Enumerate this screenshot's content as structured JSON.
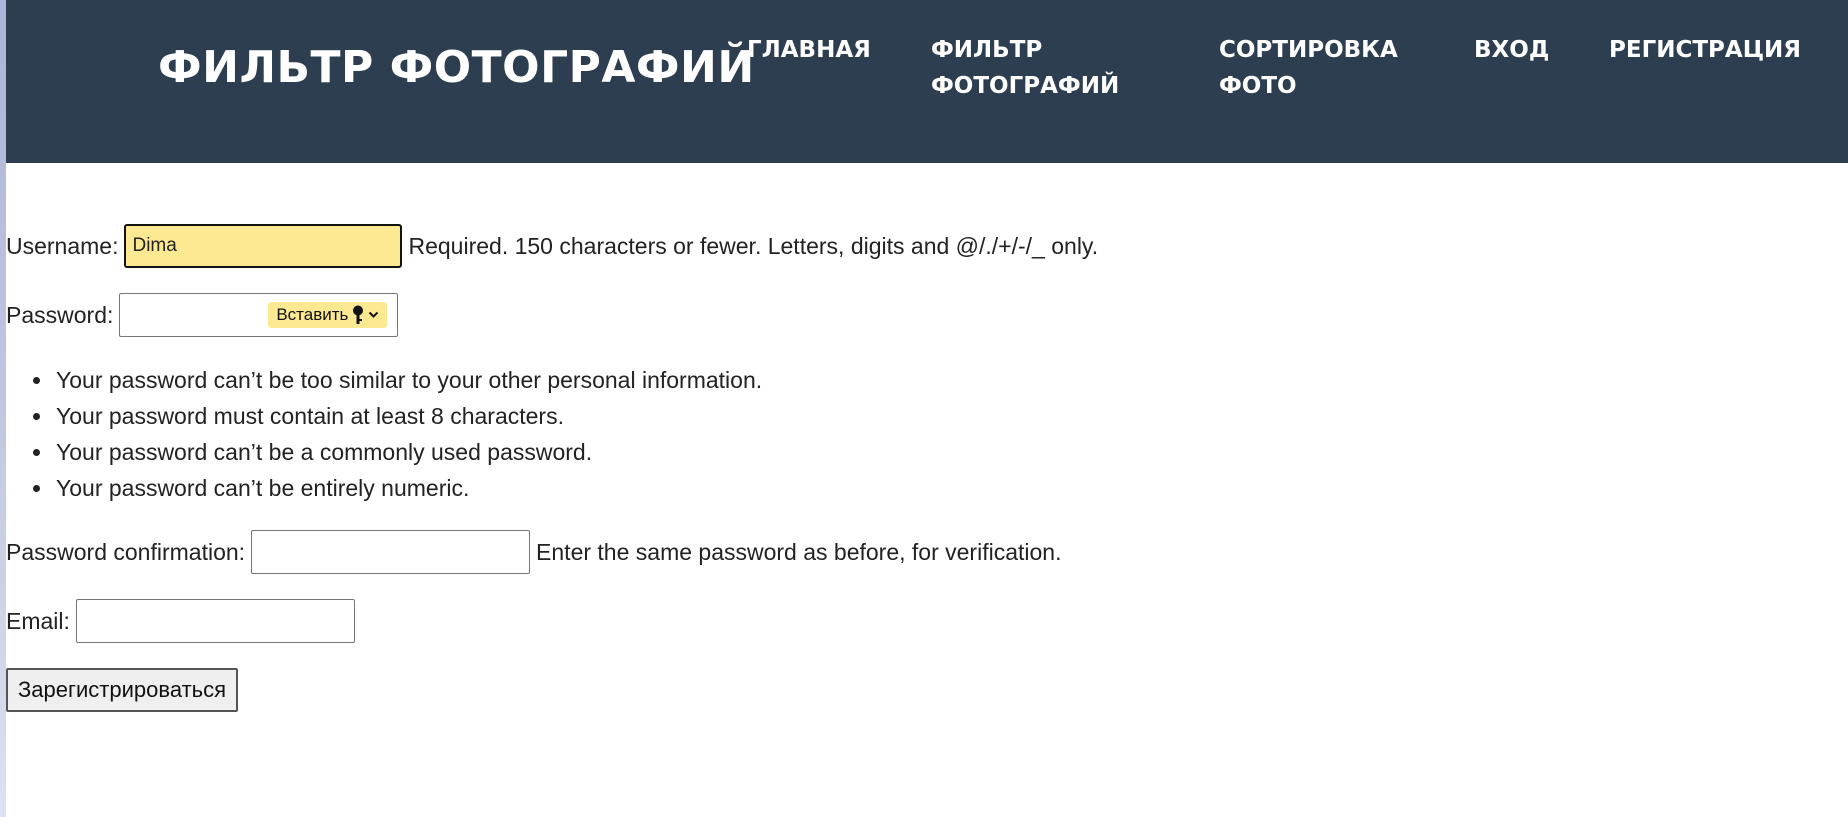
{
  "header": {
    "brand": "ФИЛЬТР ФОТОГРАФИЙ",
    "nav": {
      "home": "ГЛАВНАЯ",
      "filter_line1": "ФИЛЬТР",
      "filter_line2": "ФОТОГРАФИЙ",
      "sort_line1": "СОРТИРОВКА",
      "sort_line2": "ФОТО",
      "login": "ВХОД",
      "register": "РЕГИСТРАЦИЯ"
    },
    "colors": {
      "background": "#2c3e50",
      "text": "#ffffff"
    }
  },
  "form": {
    "username": {
      "label": "Username:",
      "value": "Dima",
      "help": "Required. 150 characters or fewer. Letters, digits and @/./+/-/_ only.",
      "autofill_color": "#fde992"
    },
    "password": {
      "label": "Password:",
      "value": "",
      "paste_button": "Вставить",
      "paste_icon": "key-icon",
      "chevron_icon": "chevron-down-icon"
    },
    "password_rules": [
      "Your password can’t be too similar to your other personal information.",
      "Your password must contain at least 8 characters.",
      "Your password can’t be a commonly used password.",
      "Your password can’t be entirely numeric."
    ],
    "password_confirmation": {
      "label": "Password confirmation:",
      "value": "",
      "help": "Enter the same password as before, for verification."
    },
    "email": {
      "label": "Email:",
      "value": ""
    },
    "submit_label": "Зарегистрироваться"
  }
}
